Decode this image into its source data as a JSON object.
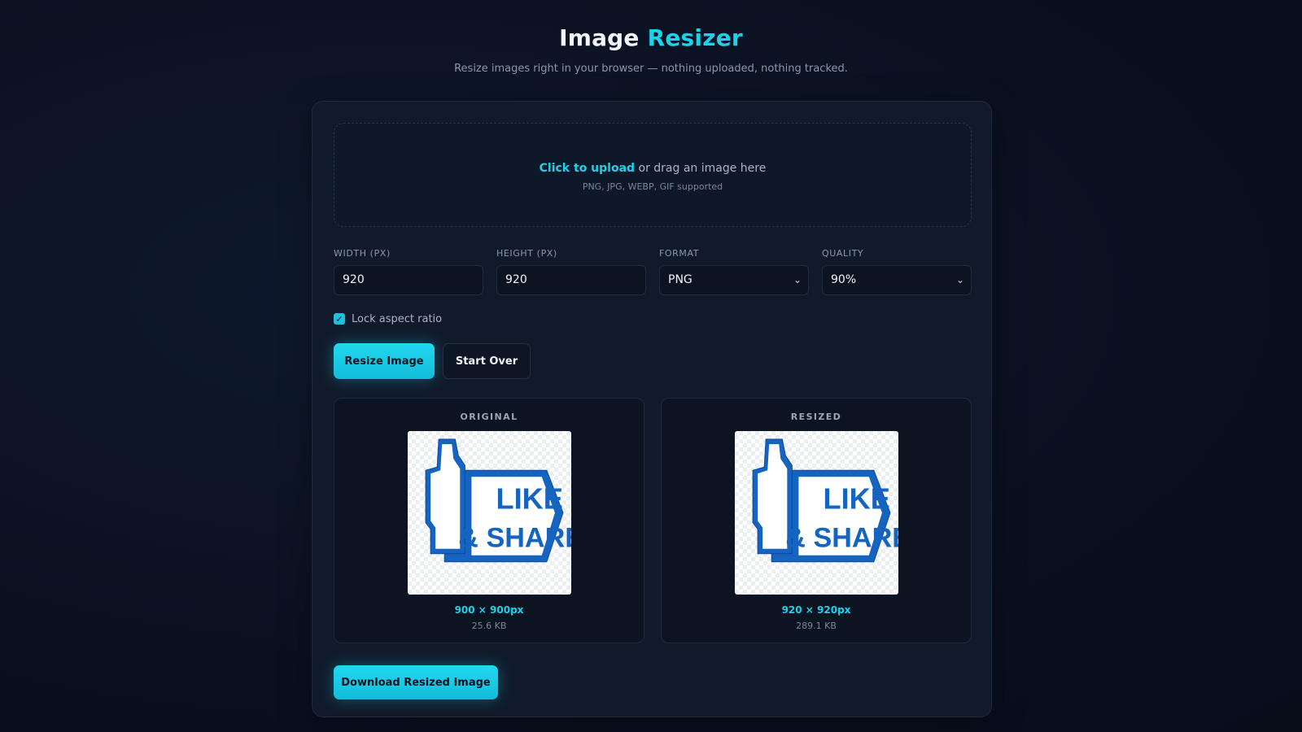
{
  "header": {
    "title_main": "Image",
    "title_accent": "Resizer",
    "subtitle": "Resize images right in your browser — nothing uploaded, nothing tracked."
  },
  "upload": {
    "link_text": "Click to upload",
    "rest_text": " or drag an image here",
    "hint": "PNG, JPG, WEBP, GIF supported"
  },
  "fields": {
    "width": {
      "label": "Width (px)",
      "value": "920"
    },
    "height": {
      "label": "Height (px)",
      "value": "920"
    },
    "format": {
      "label": "Format",
      "value": "PNG"
    },
    "quality": {
      "label": "Quality",
      "value": "90%"
    }
  },
  "lock": {
    "label": "Lock aspect ratio",
    "checked": true
  },
  "buttons": {
    "resize": "Resize Image",
    "start_over": "Start Over",
    "download": "Download Resized Image"
  },
  "preview": {
    "original": {
      "label": "ORIGINAL",
      "dims": "900 × 900px",
      "size": "25.6 KB"
    },
    "resized": {
      "label": "RESIZED",
      "dims": "920 × 920px",
      "size": "289.1 KB"
    },
    "image_text_line1": "LIKE",
    "image_text_line2": "& SHARE"
  },
  "colors": {
    "accent": "#19d3ea",
    "background": "#0a1020",
    "card": "#111a2b",
    "logo_blue": "#1565c0"
  },
  "icons": {
    "select_chevron": "chevron-down-icon",
    "checkbox_check": "check-icon",
    "image_thumb": "thumbs-up-icon"
  }
}
